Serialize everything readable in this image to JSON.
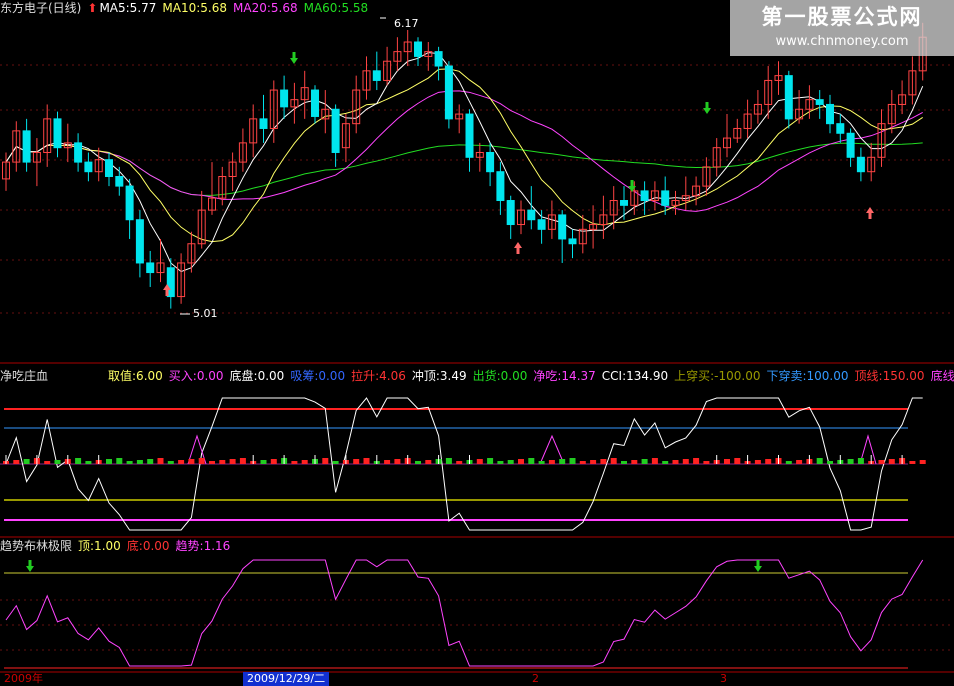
{
  "panel1": {
    "title": "东方电子(日线)",
    "ma": [
      {
        "label": "MA5:5.77",
        "color": "#ffffff"
      },
      {
        "label": "MA10:5.68",
        "color": "#ffff66"
      },
      {
        "label": "MA20:5.68",
        "color": "#ff44ff"
      },
      {
        "label": "MA60:5.58",
        "color": "#22dd22"
      }
    ],
    "high_label": "6.17",
    "low_label": "5.01"
  },
  "panel2": {
    "title": "净吃庄血",
    "items": [
      {
        "label": "取值:6.00",
        "color": "#ffff66"
      },
      {
        "label": "买入:0.00",
        "color": "#ff44ff"
      },
      {
        "label": "底盘:0.00",
        "color": "#ffffff"
      },
      {
        "label": "吸筹:0.00",
        "color": "#3366ff"
      },
      {
        "label": "拉升:4.06",
        "color": "#ff3333"
      },
      {
        "label": "冲顶:3.49",
        "color": "#ffffff"
      },
      {
        "label": "出货:0.00",
        "color": "#22dd22"
      },
      {
        "label": "净吃:14.37",
        "color": "#ff44ff"
      },
      {
        "label": "CCI:134.90",
        "color": "#ffffff"
      },
      {
        "label": "上穿买:-100.00",
        "color": "#999900"
      },
      {
        "label": "下穿卖:100.00",
        "color": "#3399ff"
      },
      {
        "label": "顶线:150.00",
        "color": "#ff3333"
      },
      {
        "label": "底线",
        "color": "#ff44ff"
      }
    ]
  },
  "panel3": {
    "title": "趋势布林极限",
    "items": [
      {
        "label": "顶:1.00",
        "color": "#ffff66"
      },
      {
        "label": "底:0.00",
        "color": "#ff3333"
      },
      {
        "label": "趋势:1.16",
        "color": "#ff44ff"
      }
    ]
  },
  "axis": {
    "year": "2009年",
    "selected_date": "2009/12/29/二",
    "month_ticks": [
      "2",
      "3"
    ]
  },
  "watermark": {
    "line1": "第一股票公式网",
    "line2": "www.chnmoney.com"
  },
  "colors": {
    "up": "#ff4444",
    "down": "#00e5ee",
    "ma5": "#ffffff",
    "ma10": "#ffff66",
    "ma20": "#ff44ff",
    "ma60": "#22dd22",
    "buy_arrow": "#ff6666",
    "sell_arrow": "#22cc22"
  },
  "chart_data": {
    "type": "candlestick",
    "candles": [
      [
        5.55,
        5.62,
        5.66,
        5.5
      ],
      [
        5.62,
        5.75,
        5.79,
        5.58
      ],
      [
        5.75,
        5.62,
        5.8,
        5.58
      ],
      [
        5.62,
        5.66,
        5.72,
        5.52
      ],
      [
        5.66,
        5.8,
        5.86,
        5.6
      ],
      [
        5.8,
        5.68,
        5.83,
        5.64
      ],
      [
        5.68,
        5.7,
        5.78,
        5.62
      ],
      [
        5.7,
        5.62,
        5.74,
        5.58
      ],
      [
        5.62,
        5.58,
        5.66,
        5.54
      ],
      [
        5.58,
        5.63,
        5.68,
        5.54
      ],
      [
        5.63,
        5.56,
        5.66,
        5.52
      ],
      [
        5.56,
        5.52,
        5.6,
        5.48
      ],
      [
        5.52,
        5.38,
        5.55,
        5.3
      ],
      [
        5.38,
        5.2,
        5.42,
        5.14
      ],
      [
        5.2,
        5.16,
        5.25,
        5.1
      ],
      [
        5.16,
        5.2,
        5.3,
        5.12
      ],
      [
        5.18,
        5.06,
        5.22,
        5.01
      ],
      [
        5.06,
        5.2,
        5.24,
        5.03
      ],
      [
        5.2,
        5.28,
        5.33,
        5.16
      ],
      [
        5.28,
        5.42,
        5.5,
        5.26
      ],
      [
        5.42,
        5.47,
        5.62,
        5.4
      ],
      [
        5.47,
        5.56,
        5.6,
        5.44
      ],
      [
        5.56,
        5.62,
        5.66,
        5.5
      ],
      [
        5.62,
        5.7,
        5.76,
        5.58
      ],
      [
        5.7,
        5.8,
        5.86,
        5.64
      ],
      [
        5.8,
        5.76,
        5.9,
        5.7
      ],
      [
        5.76,
        5.92,
        5.96,
        5.7
      ],
      [
        5.92,
        5.85,
        5.98,
        5.8
      ],
      [
        5.85,
        5.88,
        5.95,
        5.78
      ],
      [
        5.88,
        5.93,
        6.0,
        5.8
      ],
      [
        5.92,
        5.81,
        5.94,
        5.78
      ],
      [
        5.8,
        5.84,
        5.92,
        5.74
      ],
      [
        5.84,
        5.66,
        5.86,
        5.6
      ],
      [
        5.68,
        5.78,
        5.82,
        5.62
      ],
      [
        5.78,
        5.92,
        5.98,
        5.74
      ],
      [
        5.92,
        6.0,
        6.06,
        5.88
      ],
      [
        6.0,
        5.96,
        6.08,
        5.92
      ],
      [
        5.96,
        6.04,
        6.1,
        5.94
      ],
      [
        6.04,
        6.08,
        6.14,
        6.0
      ],
      [
        6.08,
        6.12,
        6.17,
        6.02
      ],
      [
        6.12,
        6.06,
        6.14,
        6.02
      ],
      [
        6.06,
        6.08,
        6.12,
        6.0
      ],
      [
        6.08,
        6.02,
        6.1,
        5.96
      ],
      [
        6.02,
        5.8,
        6.04,
        5.76
      ],
      [
        5.8,
        5.82,
        5.86,
        5.74
      ],
      [
        5.82,
        5.64,
        5.84,
        5.58
      ],
      [
        5.64,
        5.66,
        5.7,
        5.58
      ],
      [
        5.66,
        5.58,
        5.7,
        5.52
      ],
      [
        5.58,
        5.46,
        5.62,
        5.4
      ],
      [
        5.46,
        5.36,
        5.48,
        5.3
      ],
      [
        5.36,
        5.42,
        5.46,
        5.32
      ],
      [
        5.42,
        5.38,
        5.52,
        5.34
      ],
      [
        5.38,
        5.34,
        5.42,
        5.28
      ],
      [
        5.34,
        5.4,
        5.46,
        5.3
      ],
      [
        5.4,
        5.3,
        5.42,
        5.2
      ],
      [
        5.3,
        5.28,
        5.34,
        5.22
      ],
      [
        5.28,
        5.34,
        5.4,
        5.24
      ],
      [
        5.34,
        5.36,
        5.44,
        5.26
      ],
      [
        5.36,
        5.4,
        5.48,
        5.3
      ],
      [
        5.4,
        5.46,
        5.52,
        5.34
      ],
      [
        5.46,
        5.44,
        5.52,
        5.38
      ],
      [
        5.44,
        5.5,
        5.54,
        5.4
      ],
      [
        5.5,
        5.46,
        5.54,
        5.4
      ],
      [
        5.46,
        5.5,
        5.54,
        5.42
      ],
      [
        5.5,
        5.44,
        5.56,
        5.4
      ],
      [
        5.44,
        5.46,
        5.5,
        5.4
      ],
      [
        5.46,
        5.48,
        5.56,
        5.42
      ],
      [
        5.48,
        5.52,
        5.56,
        5.44
      ],
      [
        5.52,
        5.6,
        5.64,
        5.48
      ],
      [
        5.6,
        5.68,
        5.72,
        5.56
      ],
      [
        5.68,
        5.72,
        5.82,
        5.64
      ],
      [
        5.72,
        5.76,
        5.8,
        5.7
      ],
      [
        5.76,
        5.82,
        5.88,
        5.72
      ],
      [
        5.82,
        5.86,
        5.92,
        5.78
      ],
      [
        5.86,
        5.96,
        6.02,
        5.8
      ],
      [
        5.96,
        5.98,
        6.04,
        5.9
      ],
      [
        5.98,
        5.8,
        6.0,
        5.76
      ],
      [
        5.8,
        5.84,
        5.92,
        5.78
      ],
      [
        5.84,
        5.88,
        5.94,
        5.8
      ],
      [
        5.88,
        5.86,
        5.92,
        5.8
      ],
      [
        5.86,
        5.78,
        5.9,
        5.74
      ],
      [
        5.78,
        5.74,
        5.82,
        5.7
      ],
      [
        5.74,
        5.64,
        5.76,
        5.6
      ],
      [
        5.64,
        5.58,
        5.68,
        5.54
      ],
      [
        5.58,
        5.64,
        5.7,
        5.54
      ],
      [
        5.64,
        5.78,
        5.84,
        5.6
      ],
      [
        5.78,
        5.86,
        5.92,
        5.74
      ],
      [
        5.86,
        5.9,
        5.96,
        5.82
      ],
      [
        5.9,
        6.0,
        6.06,
        5.86
      ],
      [
        6.0,
        6.14,
        6.2,
        5.96
      ]
    ]
  }
}
